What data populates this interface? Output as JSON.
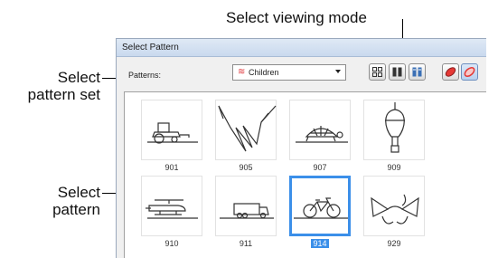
{
  "callouts": {
    "viewing_mode": "Select viewing mode",
    "pattern_set_line1": "Select",
    "pattern_set_line2": "pattern set",
    "pattern_line1": "Select",
    "pattern_line2": "pattern"
  },
  "dialog": {
    "title": "Select Pattern",
    "patterns_label": "Patterns:",
    "pattern_set": {
      "selected": "Children",
      "icon": "pattern-set-icon"
    },
    "view_buttons": [
      {
        "name": "view-small-icons",
        "icon": "grid-icon"
      },
      {
        "name": "view-large-icons",
        "icon": "columns-icon"
      },
      {
        "name": "view-details",
        "icon": "details-icon"
      }
    ],
    "color_buttons": [
      {
        "name": "color-fill",
        "color": "#e53935"
      },
      {
        "name": "color-outline",
        "color": "#ef5350"
      }
    ],
    "patterns": [
      {
        "id": "901",
        "icon": "tractor-icon"
      },
      {
        "id": "905",
        "icon": "fan-lines-icon"
      },
      {
        "id": "907",
        "icon": "turtle-icon"
      },
      {
        "id": "909",
        "icon": "hot-air-balloon-icon"
      },
      {
        "id": "910",
        "icon": "helicopter-icon"
      },
      {
        "id": "911",
        "icon": "truck-icon"
      },
      {
        "id": "914",
        "icon": "bicycle-icon",
        "selected": true
      },
      {
        "id": "929",
        "icon": "bow-icon"
      }
    ],
    "accent": "#3b8fe9"
  }
}
